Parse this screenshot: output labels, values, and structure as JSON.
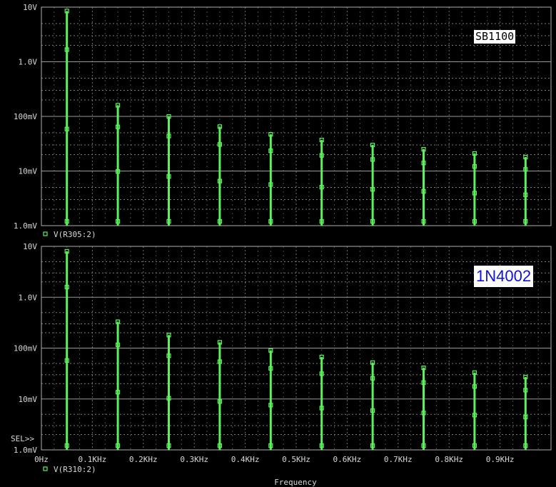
{
  "sel_marker": "SEL>>",
  "x_axis_title": "Frequency",
  "colors": {
    "trace": "#5cf25c",
    "grid": "#7a7a7a",
    "text": "#d8d8d8",
    "background": "#000000"
  },
  "chart_data": [
    {
      "type": "line",
      "title": "SB1100",
      "xlabel": "Frequency",
      "ylabel": "",
      "log_y": true,
      "xlim": [
        0,
        1000
      ],
      "ylim": [
        0.001,
        10
      ],
      "x_tick_labels": [
        "0Hz",
        "0.1KHz",
        "0.2KHz",
        "0.3KHz",
        "0.4KHz",
        "0.5KHz",
        "0.6KHz",
        "0.7KHz",
        "0.8KHz",
        "0.9KHz"
      ],
      "y_tick_labels": [
        "10V",
        "1.0V",
        "100mV",
        "10mV",
        "1.0mV"
      ],
      "legend": "V(R305:2)",
      "legend_position": "bottom-left",
      "grid": true,
      "series": [
        {
          "name": "V(R305:2)",
          "x": [
            50,
            150,
            250,
            350,
            450,
            550,
            650,
            750,
            850,
            950
          ],
          "y": [
            8.5,
            0.16,
            0.1,
            0.065,
            0.047,
            0.037,
            0.03,
            0.025,
            0.021,
            0.018
          ]
        }
      ]
    },
    {
      "type": "line",
      "title": "1N4002",
      "xlabel": "Frequency",
      "ylabel": "",
      "log_y": true,
      "xlim": [
        0,
        1000
      ],
      "ylim": [
        0.001,
        10
      ],
      "x_tick_labels": [
        "0Hz",
        "0.1KHz",
        "0.2KHz",
        "0.3KHz",
        "0.4KHz",
        "0.5KHz",
        "0.6KHz",
        "0.7KHz",
        "0.8KHz",
        "0.9KHz"
      ],
      "y_tick_labels": [
        "10V",
        "1.0V",
        "100mV",
        "10mV",
        "1.0mV"
      ],
      "legend": "V(R310:2)",
      "legend_position": "bottom-left",
      "grid": true,
      "series": [
        {
          "name": "V(R310:2)",
          "x": [
            50,
            150,
            250,
            350,
            450,
            550,
            650,
            750,
            850,
            950
          ],
          "y": [
            8.0,
            0.33,
            0.18,
            0.13,
            0.09,
            0.067,
            0.052,
            0.041,
            0.033,
            0.027
          ]
        }
      ]
    }
  ]
}
